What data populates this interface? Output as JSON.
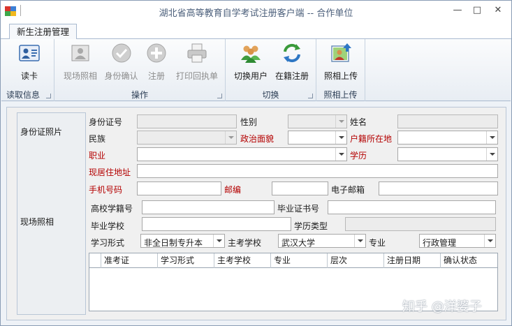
{
  "window": {
    "title": "湖北省高等教育自学考试注册客户端 -- 合作单位",
    "min": "—",
    "max": "□",
    "close": "✕"
  },
  "tabs": [
    {
      "label": "新生注册管理"
    }
  ],
  "ribbon": {
    "groups": [
      {
        "label": "读取信息",
        "buttons": [
          {
            "label": "读卡",
            "icon": "id-card-icon",
            "enabled": true
          }
        ]
      },
      {
        "label": "操作",
        "buttons": [
          {
            "label": "现场照相",
            "icon": "photo-camera-icon",
            "enabled": false
          },
          {
            "label": "身份确认",
            "icon": "check-circle-icon",
            "enabled": false
          },
          {
            "label": "注册",
            "icon": "plus-circle-icon",
            "enabled": false
          },
          {
            "label": "打印回执单",
            "icon": "printer-icon",
            "enabled": false
          }
        ]
      },
      {
        "label": "切换",
        "buttons": [
          {
            "label": "切换用户",
            "icon": "users-icon",
            "enabled": true
          },
          {
            "label": "在籍注册",
            "icon": "refresh-arrows-icon",
            "enabled": true
          }
        ]
      },
      {
        "label": "照相上传",
        "buttons": [
          {
            "label": "照相上传",
            "icon": "photo-upload-icon",
            "enabled": true
          }
        ]
      }
    ]
  },
  "side": {
    "id_photo": "身份证照片",
    "live_photo": "现场照相"
  },
  "form": {
    "id_number": {
      "label": "身份证号",
      "value": ""
    },
    "gender": {
      "label": "性别",
      "value": ""
    },
    "name": {
      "label": "姓名",
      "value": ""
    },
    "ethnicity": {
      "label": "民族",
      "value": ""
    },
    "political": {
      "label": "政治面貌",
      "value": ""
    },
    "hukou": {
      "label": "户籍所在地",
      "value": ""
    },
    "occupation": {
      "label": "职业",
      "value": ""
    },
    "education": {
      "label": "学历",
      "value": ""
    },
    "address": {
      "label": "现居住地址",
      "value": ""
    },
    "mobile": {
      "label": "手机号码",
      "value": ""
    },
    "postcode": {
      "label": "邮编",
      "value": ""
    },
    "email": {
      "label": "电子邮箱",
      "value": ""
    },
    "college_no": {
      "label": "高校学籍号",
      "value": ""
    },
    "diploma_no": {
      "label": "毕业证书号",
      "value": ""
    },
    "grad_school": {
      "label": "毕业学校",
      "value": ""
    },
    "edu_type": {
      "label": "学历类型",
      "value": ""
    },
    "study_mode": {
      "label": "学习形式",
      "value": "非全日制专升本"
    },
    "main_school": {
      "label": "主考学校",
      "value": "武汉大学"
    },
    "major": {
      "label": "专业",
      "value": "行政管理"
    }
  },
  "grid": {
    "columns": [
      "准考证",
      "学习形式",
      "主考学校",
      "专业",
      "层次",
      "注册日期",
      "确认状态"
    ]
  },
  "watermark": "知乎 @洋婆子",
  "colors": {
    "required_label": "#b40000",
    "ribbon_border": "#a8b9cf"
  }
}
